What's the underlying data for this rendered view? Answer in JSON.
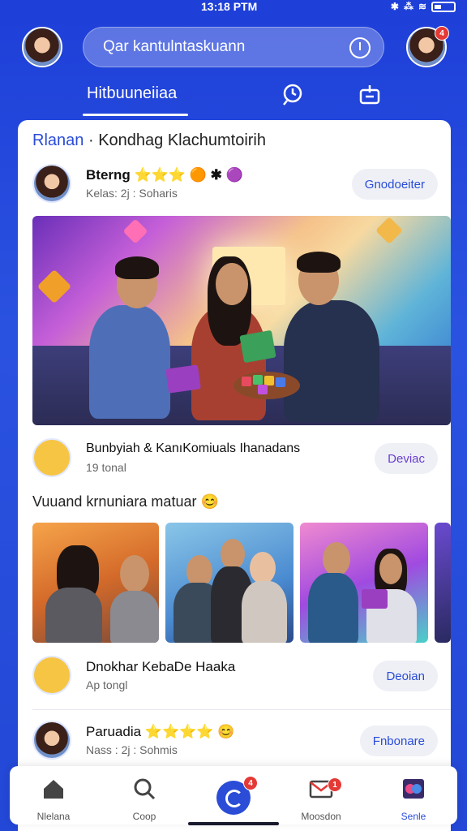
{
  "status_bar": {
    "time": "13:18 PTM",
    "icons": [
      "bluetooth-icon",
      "signal-icon",
      "battery-icon"
    ]
  },
  "header": {
    "search_placeholder": "Qar kantulntaskuann",
    "right_avatar_badge": "4"
  },
  "tabs": {
    "active_label": "Hitbuuneiiaa"
  },
  "feed": {
    "header_accent": "Rlanan",
    "header_separator": "·",
    "header_title": "Kondhag Klachumtoirih",
    "post1": {
      "title": "Bterng ⭐⭐⭐ 🟠 ✱ 🟣",
      "subtitle": "Kelas: 2j : Soharis",
      "button": "Gnodoeiter"
    },
    "post2": {
      "title": "Bunbyiah & KanıKomiuals Ihanadans",
      "subtitle": "19 tonal",
      "button": "Deviac"
    },
    "section_label": "Vuuand krnuniara matuar 😊",
    "post3": {
      "title": "Dnokhar KebaDe Haaka",
      "subtitle": "Ap tongl",
      "button": "Deoian"
    },
    "post4": {
      "title": "Paruadia ⭐⭐⭐⭐ 😊",
      "subtitle": "Nass : 2j : Sohmis",
      "button": "Fnbonare"
    }
  },
  "bottom_nav": {
    "items": [
      {
        "label": "Nlelana",
        "icon": "home-icon"
      },
      {
        "label": "Coop",
        "icon": "search-icon"
      },
      {
        "label": "",
        "icon": "create-icon",
        "badge": "4"
      },
      {
        "label": "Moosdon",
        "icon": "mail-icon",
        "badge": "1"
      },
      {
        "label": "Senle",
        "icon": "profile-icon"
      }
    ]
  },
  "colors": {
    "accent": "#2a4cd7",
    "badge": "#e53935",
    "background": "#2347d6"
  }
}
